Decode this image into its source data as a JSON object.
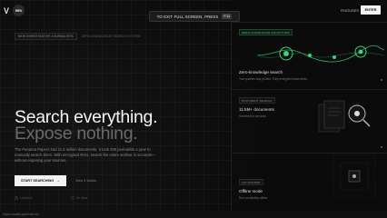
{
  "logo": {
    "mark": "V",
    "badge": "95%"
  },
  "banner": {
    "text": "TO EXIT FULL SCREEN, PRESS",
    "key": "F11"
  },
  "nav": {
    "link": "FEATURES",
    "enter": "ENTER"
  },
  "tags": {
    "primary": "NEW INVESTIGATIVE JOURNALISTS",
    "secondary": "ZERO-KNOWLEDGE SEARCH SYSTEM"
  },
  "hero": {
    "line1": "Search everything.",
    "line2": "Expose nothing.",
    "description": "The Panama Papers had 11.5 million documents. It took 400 journalists a year to manually search them. With encrypted RAG, search the entire archive in seconds—without exposing your sources."
  },
  "cta": {
    "label": "START SEARCHING",
    "arrow": "→",
    "secondary": "View 4 Works"
  },
  "meta": {
    "item1": "Locked-in",
    "item2": "No leaks"
  },
  "footer": {
    "url": "https://vaultly.app/enter/do"
  },
  "cards": [
    {
      "label": "ZERO-KNOWLEDGE ENCRYPTED",
      "title": "Zero-knowledge search",
      "sub": "Your queries stay private. Fully encrypted documents."
    },
    {
      "label": "DOCUMENT SEARCH",
      "title": "11.5M+ documents",
      "sub": "Searched in seconds"
    },
    {
      "label": "AIR-GAPPED",
      "title": "Offline mode",
      "sub": "Run completely offline"
    }
  ],
  "colors": {
    "accent": "#3fd07a",
    "background": "#0b0b0c"
  }
}
